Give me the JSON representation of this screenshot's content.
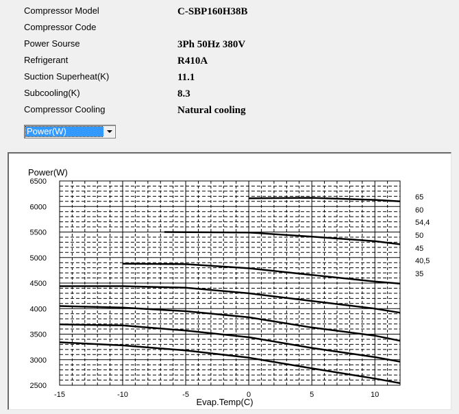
{
  "info": [
    {
      "label": "Compressor  Model",
      "value": "C-SBP160H38B"
    },
    {
      "label": "Compressor Code",
      "value": ""
    },
    {
      "label": "Power Sourse",
      "value": "3Ph  50Hz  380V"
    },
    {
      "label": "Refrigerant",
      "value": "R410A"
    },
    {
      "label": "Suction Superheat(K)",
      "value": "11.1"
    },
    {
      "label": "Subcooling(K)",
      "value": "8.3"
    },
    {
      "label": "Compressor Cooling",
      "value": "Natural cooling"
    }
  ],
  "dropdown": {
    "selected": "Power(W)"
  },
  "chart_data": {
    "type": "line",
    "title": "",
    "xlabel": "Evap.Temp(C)",
    "ylabel": "Power(W)",
    "xlim": [
      -15,
      12
    ],
    "ylim": [
      2500,
      6500
    ],
    "x_ticks": [
      -15,
      -10,
      -5,
      0,
      5,
      10
    ],
    "x_tick_labels": [
      "-15",
      "-10",
      "-5",
      "0",
      "5",
      "10"
    ],
    "y_ticks": [
      2500,
      3000,
      3500,
      4000,
      4500,
      5000,
      5500,
      6000,
      6500
    ],
    "y_tick_labels": [
      "2500",
      "3000",
      "3500",
      "4000",
      "4500",
      "5000",
      "5500",
      "6000",
      "6500"
    ],
    "grid": {
      "major": true,
      "minor_dashed": true,
      "x_minor_step": 1,
      "y_minor_step": 100
    },
    "legend_title": "",
    "legend_labels": [
      "65",
      "60",
      "54,4",
      "50",
      "45",
      "40,5",
      "35"
    ],
    "legend_position": "right",
    "series": [
      {
        "name": "65",
        "x": [
          0,
          5,
          10,
          12
        ],
        "y": [
          6160,
          6170,
          6130,
          6100
        ]
      },
      {
        "name": "60",
        "x": [
          -6.7,
          0,
          5,
          10,
          12
        ],
        "y": [
          5500,
          5490,
          5410,
          5320,
          5260
        ]
      },
      {
        "name": "54,4",
        "x": [
          -10,
          -5,
          0,
          5,
          10,
          12
        ],
        "y": [
          4880,
          4870,
          4790,
          4660,
          4530,
          4490
        ]
      },
      {
        "name": "50",
        "x": [
          -15,
          -10,
          -5,
          0,
          5,
          10,
          12
        ],
        "y": [
          4440,
          4440,
          4410,
          4300,
          4150,
          4000,
          3920
        ]
      },
      {
        "name": "45",
        "x": [
          -15,
          -10,
          -5,
          0,
          5,
          10,
          12
        ],
        "y": [
          4050,
          4020,
          3950,
          3830,
          3630,
          3470,
          3370
        ]
      },
      {
        "name": "40,5",
        "x": [
          -15,
          -10,
          -5,
          0,
          5,
          10,
          12
        ],
        "y": [
          3690,
          3670,
          3570,
          3440,
          3230,
          3050,
          2960
        ]
      },
      {
        "name": "35",
        "x": [
          -15,
          -10,
          -5,
          0,
          5,
          10,
          12
        ],
        "y": [
          3340,
          3280,
          3180,
          3040,
          2830,
          2630,
          2540
        ]
      }
    ]
  }
}
